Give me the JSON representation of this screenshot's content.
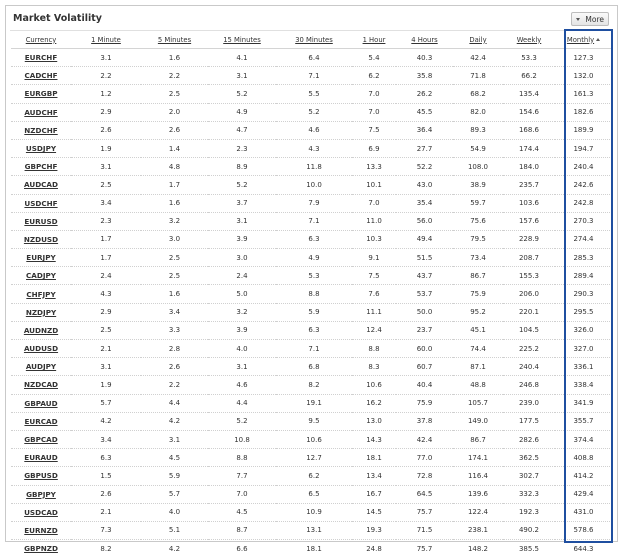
{
  "widget": {
    "title": "Market Volatility",
    "more_label": "More",
    "highlight_color": "#1f4fa0"
  },
  "columns": [
    {
      "key": "currency",
      "label": "Currency"
    },
    {
      "key": "m1",
      "label": "1 Minute"
    },
    {
      "key": "m5",
      "label": "5 Minutes"
    },
    {
      "key": "m15",
      "label": "15 Minutes"
    },
    {
      "key": "m30",
      "label": "30 Minutes"
    },
    {
      "key": "h1",
      "label": "1 Hour"
    },
    {
      "key": "h4",
      "label": "4 Hours"
    },
    {
      "key": "daily",
      "label": "Daily"
    },
    {
      "key": "weekly",
      "label": "Weekly"
    },
    {
      "key": "monthly",
      "label": "Monthly",
      "sorted": "ascending"
    }
  ],
  "rows": [
    [
      "EURCHF",
      "3.1",
      "1.6",
      "4.1",
      "6.4",
      "5.4",
      "40.3",
      "42.4",
      "53.3",
      "127.3"
    ],
    [
      "CADCHF",
      "2.2",
      "2.2",
      "3.1",
      "7.1",
      "6.2",
      "35.8",
      "71.8",
      "66.2",
      "132.0"
    ],
    [
      "EURGBP",
      "1.2",
      "2.5",
      "5.2",
      "5.5",
      "7.0",
      "26.2",
      "68.2",
      "135.4",
      "161.3"
    ],
    [
      "AUDCHF",
      "2.9",
      "2.0",
      "4.9",
      "5.2",
      "7.0",
      "45.5",
      "82.0",
      "154.6",
      "182.6"
    ],
    [
      "NZDCHF",
      "2.6",
      "2.6",
      "4.7",
      "4.6",
      "7.5",
      "36.4",
      "89.3",
      "168.6",
      "189.9"
    ],
    [
      "USDJPY",
      "1.9",
      "1.4",
      "2.3",
      "4.3",
      "6.9",
      "27.7",
      "54.9",
      "174.4",
      "194.7"
    ],
    [
      "GBPCHF",
      "3.1",
      "4.8",
      "8.9",
      "11.8",
      "13.3",
      "52.2",
      "108.0",
      "184.0",
      "240.4"
    ],
    [
      "AUDCAD",
      "2.5",
      "1.7",
      "5.2",
      "10.0",
      "10.1",
      "43.0",
      "38.9",
      "235.7",
      "242.6"
    ],
    [
      "USDCHF",
      "3.4",
      "1.6",
      "3.7",
      "7.9",
      "7.0",
      "35.4",
      "59.7",
      "103.6",
      "242.8"
    ],
    [
      "EURUSD",
      "2.3",
      "3.2",
      "3.1",
      "7.1",
      "11.0",
      "56.0",
      "75.6",
      "157.6",
      "270.3"
    ],
    [
      "NZDUSD",
      "1.7",
      "3.0",
      "3.9",
      "6.3",
      "10.3",
      "49.4",
      "79.5",
      "228.9",
      "274.4"
    ],
    [
      "EURJPY",
      "1.7",
      "2.5",
      "3.0",
      "4.9",
      "9.1",
      "51.5",
      "73.4",
      "208.7",
      "285.3"
    ],
    [
      "CADJPY",
      "2.4",
      "2.5",
      "2.4",
      "5.3",
      "7.5",
      "43.7",
      "86.7",
      "155.3",
      "289.4"
    ],
    [
      "CHFJPY",
      "4.3",
      "1.6",
      "5.0",
      "8.8",
      "7.6",
      "53.7",
      "75.9",
      "206.0",
      "290.3"
    ],
    [
      "NZDJPY",
      "2.9",
      "3.4",
      "3.2",
      "5.9",
      "11.1",
      "50.0",
      "95.2",
      "220.1",
      "295.5"
    ],
    [
      "AUDNZD",
      "2.5",
      "3.3",
      "3.9",
      "6.3",
      "12.4",
      "23.7",
      "45.1",
      "104.5",
      "326.0"
    ],
    [
      "AUDUSD",
      "2.1",
      "2.8",
      "4.0",
      "7.1",
      "8.8",
      "60.0",
      "74.4",
      "225.2",
      "327.0"
    ],
    [
      "AUDJPY",
      "3.1",
      "2.6",
      "3.1",
      "6.8",
      "8.3",
      "60.7",
      "87.1",
      "240.4",
      "336.1"
    ],
    [
      "NZDCAD",
      "1.9",
      "2.2",
      "4.6",
      "8.2",
      "10.6",
      "40.4",
      "48.8",
      "246.8",
      "338.4"
    ],
    [
      "GBPAUD",
      "5.7",
      "4.4",
      "4.4",
      "19.1",
      "16.2",
      "75.9",
      "105.7",
      "239.0",
      "341.9"
    ],
    [
      "EURCAD",
      "4.2",
      "4.2",
      "5.2",
      "9.5",
      "13.0",
      "37.8",
      "149.0",
      "177.5",
      "355.7"
    ],
    [
      "GBPCAD",
      "3.4",
      "3.1",
      "10.8",
      "10.6",
      "14.3",
      "42.4",
      "86.7",
      "282.6",
      "374.4"
    ],
    [
      "EURAUD",
      "6.3",
      "4.5",
      "8.8",
      "12.7",
      "18.1",
      "77.0",
      "174.1",
      "362.5",
      "408.8"
    ],
    [
      "GBPUSD",
      "1.5",
      "5.9",
      "7.7",
      "6.2",
      "13.4",
      "72.8",
      "116.4",
      "302.7",
      "414.2"
    ],
    [
      "GBPJPY",
      "2.6",
      "5.7",
      "7.0",
      "6.5",
      "16.7",
      "64.5",
      "139.6",
      "332.3",
      "429.4"
    ],
    [
      "USDCAD",
      "2.1",
      "4.0",
      "4.5",
      "10.9",
      "14.5",
      "75.7",
      "122.4",
      "192.3",
      "431.0"
    ],
    [
      "EURNZD",
      "7.3",
      "5.1",
      "8.7",
      "13.1",
      "19.3",
      "71.5",
      "238.1",
      "490.2",
      "578.6"
    ],
    [
      "GBPNZD",
      "8.2",
      "4.2",
      "6.6",
      "18.1",
      "24.8",
      "75.7",
      "148.2",
      "385.5",
      "644.3"
    ]
  ]
}
